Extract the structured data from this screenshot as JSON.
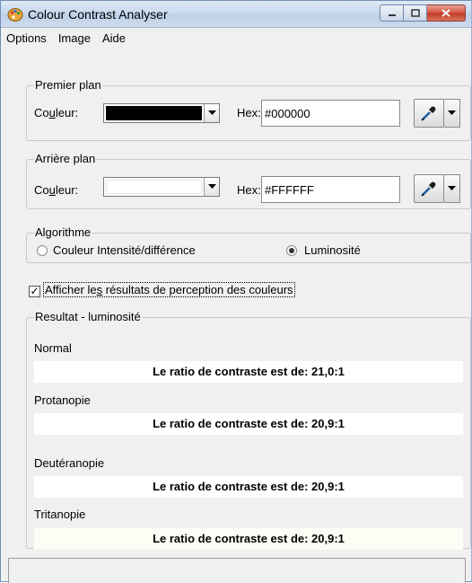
{
  "window": {
    "title": "Colour Contrast Analyser",
    "icon": "palette-icon",
    "buttons": [
      "minimize-icon",
      "maximize-icon",
      "close-icon"
    ]
  },
  "menu": [
    "Options",
    "Image",
    "Aide"
  ],
  "foreground": {
    "legend": "Premier plan",
    "color_label_pre": "Co",
    "color_label_u": "u",
    "color_label_post": "leur:",
    "hex_label": "Hex:",
    "hex_value": "#000000",
    "swatch_color": "#000000"
  },
  "background": {
    "legend": "Arrière plan",
    "color_label_pre": "Co",
    "color_label_u": "u",
    "color_label_post": "leur:",
    "hex_label": "Hex:",
    "hex_value": "#FFFFFF",
    "swatch_color": "#FFFFFF"
  },
  "algorithm": {
    "legend": "Algorithme",
    "option1": "Couleur Intensité/différence",
    "option2": "Luminosité",
    "selected": "Luminosité"
  },
  "perception_checkbox": {
    "label_pre": "Afficher le",
    "label_u": "s",
    "label_post": " résultats de perception des couleurs",
    "checked": true
  },
  "results": {
    "legend": "Resultat - luminosité",
    "items": [
      {
        "name": "Normal",
        "ratio": "Le ratio de contraste est de: 21,0:1"
      },
      {
        "name": "Protanopie",
        "ratio": "Le ratio de contraste est de: 20,9:1"
      },
      {
        "name": "Deutéranopie",
        "ratio": "Le ratio de contraste est de: 20,9:1"
      },
      {
        "name": "Tritanopie",
        "ratio": "Le ratio de contraste est de: 20,9:1"
      }
    ]
  }
}
